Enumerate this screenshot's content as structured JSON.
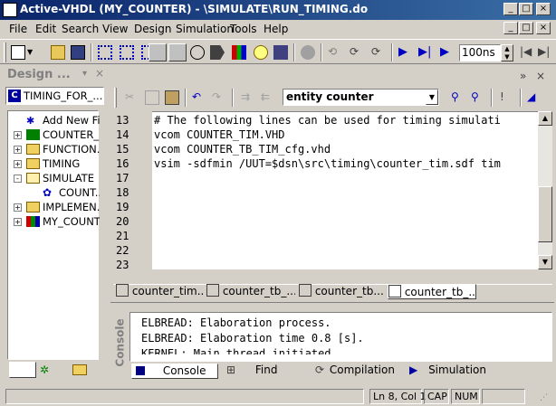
{
  "window": {
    "title": "Active-VHDL (MY_COUNTER) - \\SIMULATE\\RUN_TIMING.do"
  },
  "menu": [
    "File",
    "Edit",
    "Search",
    "View",
    "Design",
    "Simulation",
    "Tools",
    "Help"
  ],
  "toolbar": {
    "zoom_value": "100ns"
  },
  "design_panel": {
    "title": "Design ...",
    "combo_value": "TIMING_FOR_...",
    "tree": [
      {
        "label": "Add New Fil",
        "expander": "",
        "icon": "add-file-icon"
      },
      {
        "label": "COUNTER_...",
        "expander": "+",
        "icon": "entity-icon"
      },
      {
        "label": "FUNCTION...",
        "expander": "+",
        "icon": "folder-icon"
      },
      {
        "label": "TIMING",
        "expander": "+",
        "icon": "folder-icon"
      },
      {
        "label": "SIMULATE",
        "expander": "-",
        "icon": "folder-open-icon"
      },
      {
        "label": "COUNT...",
        "expander": "",
        "icon": "gear-icon"
      },
      {
        "label": "IMPLEMEN...",
        "expander": "+",
        "icon": "folder-icon"
      },
      {
        "label": "MY_COUNT...",
        "expander": "+",
        "icon": "library-icon"
      }
    ]
  },
  "editor": {
    "entity_combo": "entity counter",
    "lines": [
      {
        "num": "13",
        "text": "# The following lines can be used for timing simulati"
      },
      {
        "num": "14",
        "text": "vcom COUNTER_TIM.VHD"
      },
      {
        "num": "15",
        "text": "vcom COUNTER_TB_TIM_cfg.vhd"
      },
      {
        "num": "16",
        "text": "vsim -sdfmin /UUT=$dsn\\src\\timing\\counter_tim.sdf tim"
      },
      {
        "num": "17",
        "text": ""
      },
      {
        "num": "18",
        "text": ""
      },
      {
        "num": "19",
        "text": ""
      },
      {
        "num": "20",
        "text": ""
      },
      {
        "num": "21",
        "text": ""
      },
      {
        "num": "22",
        "text": ""
      },
      {
        "num": "23",
        "text": ""
      }
    ],
    "tabs": [
      "counter_tim...",
      "counter_tb_...",
      "counter_tb...",
      "counter_tb_..."
    ]
  },
  "console": {
    "side_label": "Console",
    "messages": [
      "ELBREAD: Elaboration process.",
      "ELBREAD: Elaboration time 0.8 [s].",
      "KERNEL: Main thread initiated"
    ],
    "tabs": [
      "Console",
      "Find",
      "Compilation",
      "Simulation"
    ]
  },
  "status": {
    "position": "Ln 8, Col 1",
    "caps": "CAP",
    "num": "NUM"
  }
}
